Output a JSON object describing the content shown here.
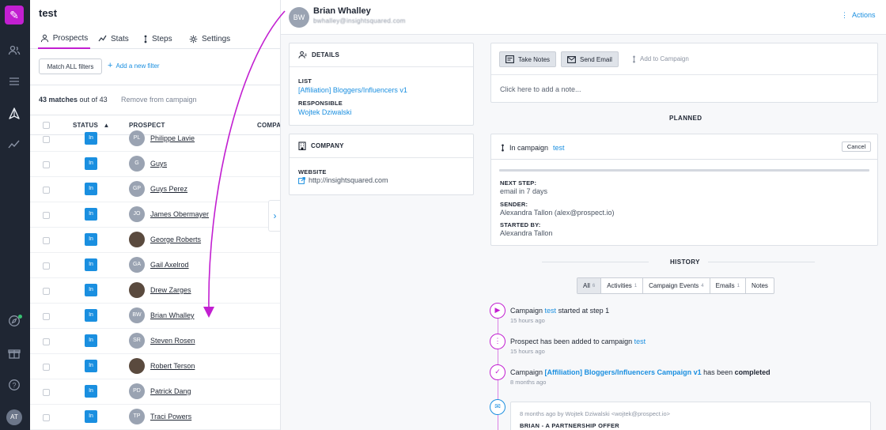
{
  "colors": {
    "brand": "#c21fd1",
    "link": "#1a8fe0",
    "rail": "#1f2633",
    "annotation": "#c21fd1"
  },
  "rail": {
    "logo_icon": "pen-icon",
    "items": [
      "prospects-icon",
      "lists-icon",
      "campaigns-icon",
      "analytics-icon"
    ],
    "bottom_items": [
      "compass-icon",
      "gift-icon",
      "help-icon"
    ],
    "avatar": "AT"
  },
  "campaign": {
    "title": "test",
    "tabs": [
      {
        "label": "Prospects",
        "icon": "people-icon"
      },
      {
        "label": "Stats",
        "icon": "chart-icon"
      },
      {
        "label": "Steps",
        "icon": "steps-icon"
      },
      {
        "label": "Settings",
        "icon": "gear-icon"
      }
    ],
    "filter_button": "Match ALL filters",
    "add_filter": "Add a new filter",
    "matches_count": "43 matches",
    "matches_total": "out of 43",
    "remove_label": "Remove from campaign",
    "columns": {
      "status": "STATUS",
      "prospect": "PROSPECT",
      "company": "COMPA"
    },
    "rows": [
      {
        "status": "In",
        "initials": "PL",
        "name": "Philippe Lavie",
        "photo": false
      },
      {
        "status": "In",
        "initials": "G",
        "name": "Guys",
        "photo": false
      },
      {
        "status": "In",
        "initials": "GP",
        "name": "Guys Perez",
        "photo": false
      },
      {
        "status": "In",
        "initials": "JO",
        "name": "James Obermayer",
        "photo": false
      },
      {
        "status": "In",
        "initials": "",
        "name": "George Roberts",
        "photo": true
      },
      {
        "status": "In",
        "initials": "GA",
        "name": "Gail Axelrod",
        "photo": false
      },
      {
        "status": "In",
        "initials": "",
        "name": "Drew Zarges",
        "photo": true
      },
      {
        "status": "In",
        "initials": "BW",
        "name": "Brian Whalley",
        "photo": false
      },
      {
        "status": "In",
        "initials": "SR",
        "name": "Steven Rosen",
        "photo": false
      },
      {
        "status": "In",
        "initials": "",
        "name": "Robert Terson",
        "photo": true
      },
      {
        "status": "In",
        "initials": "PD",
        "name": "Patrick Dang",
        "photo": false
      },
      {
        "status": "In",
        "initials": "TP",
        "name": "Traci Powers",
        "photo": false
      }
    ]
  },
  "prospect": {
    "initials": "BW",
    "name": "Brian Whalley",
    "email_obscured": "bwhalley@insightsquared.com",
    "actions": "Actions",
    "details": {
      "title": "DETAILS",
      "list_label": "LIST",
      "list_value": "[Affiliation] Bloggers/Influencers v1",
      "responsible_label": "RESPONSIBLE",
      "responsible_value": "Wojtek Dziwalski"
    },
    "company": {
      "title": "COMPANY",
      "website_label": "WEBSITE",
      "website_value": "http://insightsquared.com"
    }
  },
  "notes": {
    "take_notes": "Take Notes",
    "send_email": "Send Email",
    "add_to_campaign": "Add to Campaign",
    "placeholder": "Click here to add a note..."
  },
  "planned": {
    "title": "PLANNED",
    "in_campaign": "In campaign",
    "campaign_name": "test",
    "cancel": "Cancel",
    "next_step_label": "NEXT STEP:",
    "next_step_value": "email in 7 days",
    "sender_label": "SENDER:",
    "sender_value": "Alexandra Tallon (alex@prospect.io)",
    "started_by_label": "STARTED BY:",
    "started_by_value": "Alexandra Tallon"
  },
  "history": {
    "title": "HISTORY",
    "filters": [
      {
        "label": "All",
        "count": "6",
        "active": true
      },
      {
        "label": "Activities",
        "count": "1",
        "active": false
      },
      {
        "label": "Campaign Events",
        "count": "4",
        "active": false
      },
      {
        "label": "Emails",
        "count": "1",
        "active": false
      },
      {
        "label": "Notes",
        "count": "",
        "active": false
      }
    ],
    "events": [
      {
        "icon": "play-icon",
        "pre": "Campaign",
        "link": "test",
        "post": "started at step 1",
        "bold": "",
        "time": "15 hours ago"
      },
      {
        "icon": "steps-icon",
        "pre": "Prospect has been added to campaign",
        "link": "test",
        "post": "",
        "bold": "",
        "time": "15 hours ago"
      },
      {
        "icon": "check-icon",
        "pre": "Campaign",
        "link": "[Affiliation] Bloggers/Influencers Campaign v1",
        "post": "has been",
        "bold": "completed",
        "time": "8 months ago"
      }
    ],
    "email": {
      "icon": "mail-icon",
      "meta": "8 months ago by Wojtek Dziwalski <wojtek@prospect.io>",
      "subject": "BRIAN - A PARTNERSHIP OFFER"
    }
  }
}
